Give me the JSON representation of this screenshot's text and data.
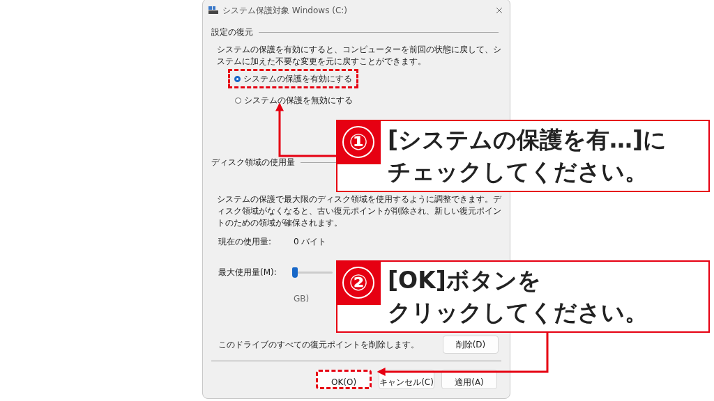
{
  "window": {
    "title": "システム保護対象 Windows (C:)"
  },
  "restore_settings": {
    "heading": "設定の復元",
    "description": "システムの保護を有効にすると、コンピューターを前回の状態に戻して、システムに加えた不要な変更を元に戻すことができます。",
    "options": [
      {
        "label": "システムの保護を有効にする",
        "selected": true,
        "highlighted": true
      },
      {
        "label": "システムの保護を無効にする",
        "selected": false,
        "highlighted": false
      }
    ]
  },
  "disk_usage": {
    "heading": "ディスク領域の使用量",
    "description": "システムの保護で最大限のディスク領域を使用するように調整できます。ディスク領域がなくなると、古い復元ポイントが削除され、新しい復元ポイントのための領域が確保されます。",
    "current_usage_label": "現在の使用量:",
    "current_usage_value": "0 バイト",
    "max_usage_label": "最大使用量(M):",
    "max_usage": {
      "level": 0.04
    },
    "max_usage_reading": "GB)",
    "delete_description": "このドライブのすべての復元ポイントを削除します。",
    "delete_button": "削除(D)"
  },
  "buttons": [
    {
      "label": "OK(O)",
      "highlighted": true
    },
    {
      "label": "キャンセル(C)",
      "highlighted": false
    },
    {
      "label": "適用(A)",
      "highlighted": false
    }
  ],
  "annotations": [
    {
      "number": "①",
      "lines": [
        "[システムの保護を有…]に",
        "チェックしてください。"
      ]
    },
    {
      "number": "②",
      "lines": [
        "[OK]ボタンを",
        "クリックしてください。"
      ]
    }
  ]
}
